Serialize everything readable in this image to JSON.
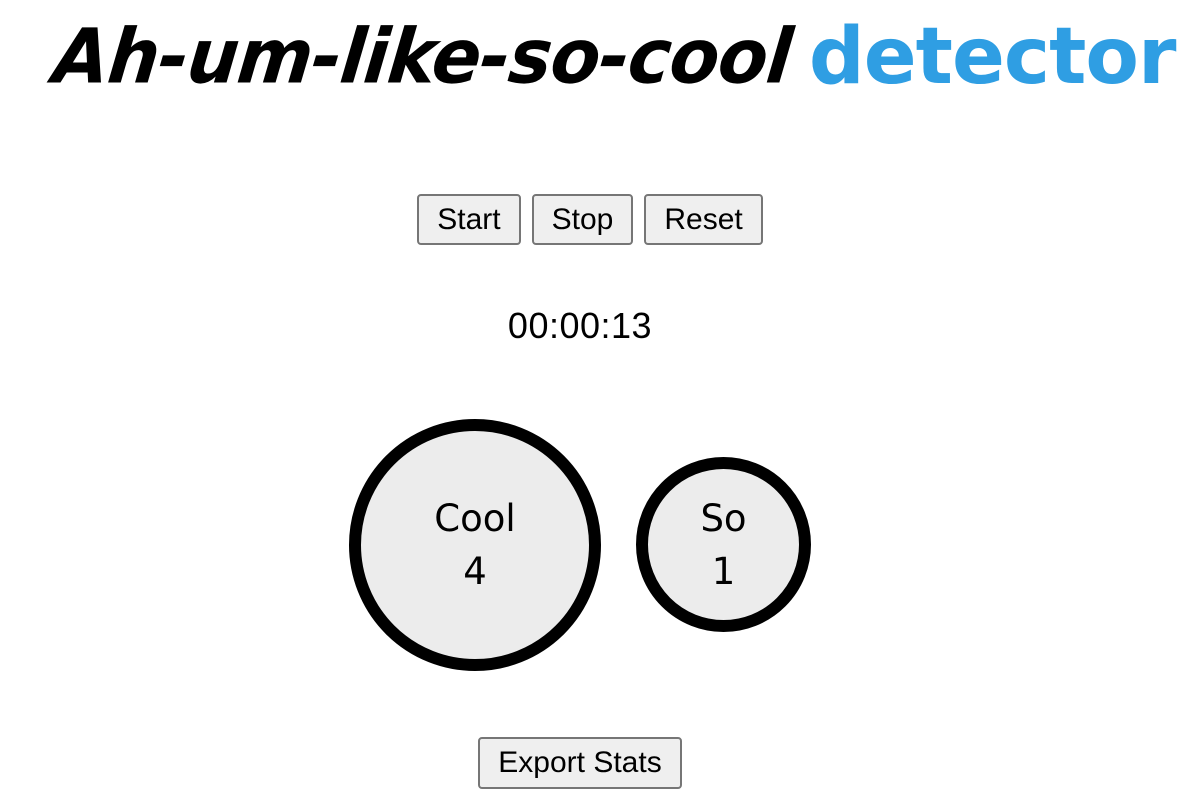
{
  "header": {
    "title_main": "Ah-um-like-so-cool",
    "title_accent": "detector"
  },
  "controls": {
    "start_label": "Start",
    "stop_label": "Stop",
    "reset_label": "Reset"
  },
  "timer": {
    "elapsed": "00:00:13"
  },
  "words": [
    {
      "label": "Cool",
      "count": "4"
    },
    {
      "label": "So",
      "count": "1"
    }
  ],
  "footer": {
    "export_label": "Export Stats"
  },
  "colors": {
    "accent": "#2f9ee3",
    "bubble_fill": "#ececec",
    "bubble_border": "#000000"
  }
}
